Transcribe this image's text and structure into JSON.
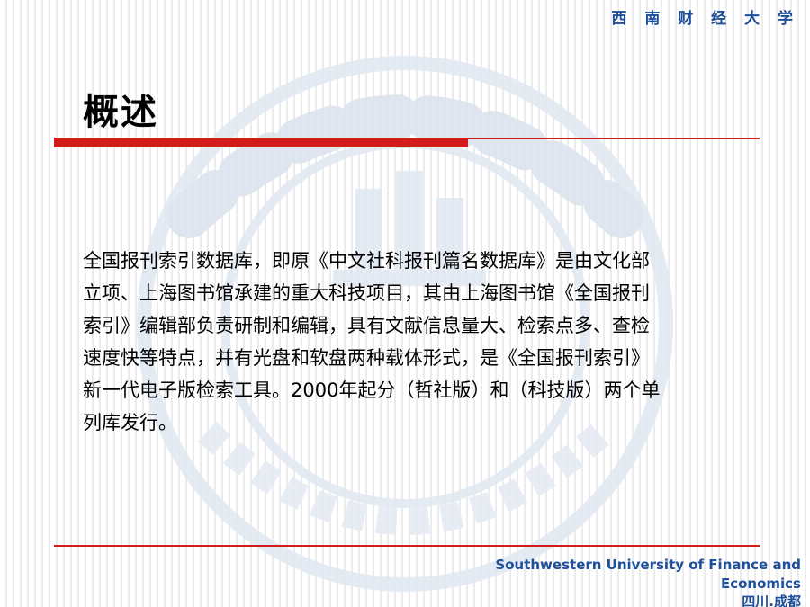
{
  "header": {
    "school_name_cn": "西 南 财 经 大 学"
  },
  "slide": {
    "title": "概述",
    "body_lines": [
      "全国报刊索引数据库，即原《中文社科报刊篇名数据库》是由文化部",
      "立项、上海图书馆承建的重大科技项目，其由上海图书馆《全国报刊",
      "索引》编辑部负责研制和编辑，具有文献信息量大、检索点多、查检",
      "速度快等特点，并有光盘和软盘两种载体形式，是《全国报刊索引》",
      "新一代电子版检索工具。2000年起分（哲社版）和（科技版）两个单",
      "列库发行。"
    ]
  },
  "footer": {
    "english_line1": "Southwestern University of Finance and",
    "english_line2": "Economics",
    "location": "四川.成都"
  },
  "colors": {
    "accent_red": "#d21c1c",
    "brand_blue": "#1e4f9a",
    "watermark_blue": "#dfe6f0"
  },
  "icons": {
    "watermark": "university-seal-watermark"
  }
}
